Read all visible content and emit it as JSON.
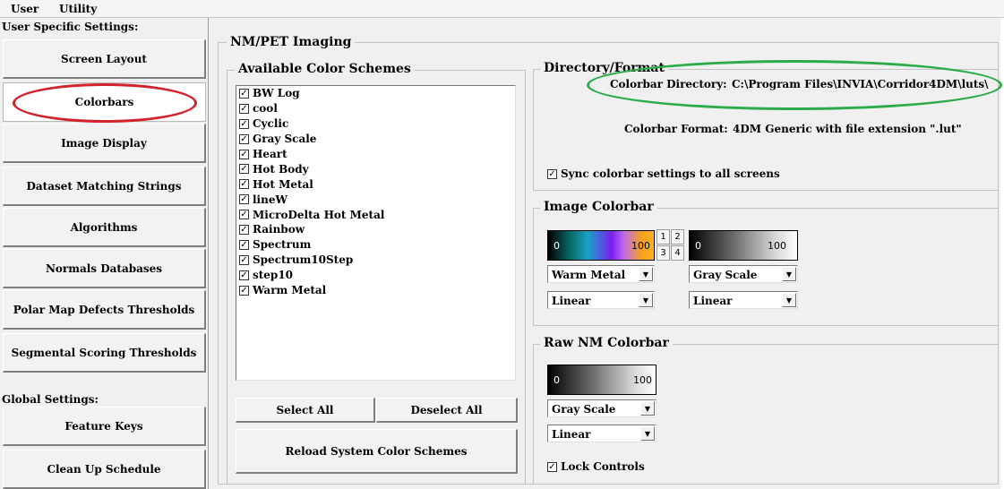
{
  "menu": {
    "user": "User",
    "utility": "Utility"
  },
  "sidebar": {
    "user_heading": "User Specific Settings:",
    "global_heading": "Global Settings:",
    "items": [
      {
        "label": "Screen Layout"
      },
      {
        "label": "Colorbars"
      },
      {
        "label": "Image Display"
      },
      {
        "label": "Dataset Matching Strings"
      },
      {
        "label": "Algorithms"
      },
      {
        "label": "Normals Databases"
      },
      {
        "label": "Polar Map Defects Thresholds"
      },
      {
        "label": "Segmental Scoring Thresholds"
      }
    ],
    "global_items": [
      {
        "label": "Feature Keys"
      },
      {
        "label": "Clean Up Schedule"
      }
    ]
  },
  "panel": {
    "title": "NM/PET Imaging",
    "schemes": {
      "title": "Available Color Schemes",
      "items": [
        "BW Log",
        "cool",
        "Cyclic",
        "Gray Scale",
        "Heart",
        "Hot Body",
        "Hot Metal",
        "lineW",
        "MicroDelta Hot Metal",
        "Rainbow",
        "Spectrum",
        "Spectrum10Step",
        "step10",
        "Warm Metal"
      ],
      "check_mark": "✓",
      "select_all": "Select All",
      "deselect_all": "Deselect All",
      "reload": "Reload System Color Schemes"
    },
    "directory": {
      "title": "Directory/Format",
      "dir_label": "Colorbar Directory:",
      "dir_value": "C:\\Program Files\\INVIA\\Corridor4DM\\luts\\",
      "format_label": "Colorbar Format:",
      "format_value": "4DM Generic with file extension \".lut\"",
      "sync_label": "Sync colorbar settings to all screens",
      "sync_checked": "✓"
    },
    "image_colorbar": {
      "title": "Image Colorbar",
      "bar1_min": "0",
      "bar1_max": "100",
      "bar2_min": "0",
      "bar2_max": "100",
      "screens": [
        "1",
        "2",
        "3",
        "4"
      ],
      "scheme1": "Warm Metal",
      "scale1": "Linear",
      "scheme2": "Gray Scale",
      "scale2": "Linear",
      "arrow": "▼"
    },
    "raw_colorbar": {
      "title": "Raw NM Colorbar",
      "bar_min": "0",
      "bar_max": "100",
      "scheme": "Gray Scale",
      "scale": "Linear",
      "lock_label": "Lock Controls",
      "lock_checked": "✓"
    }
  },
  "colors": {
    "red_highlight": "#d2222c",
    "green_highlight": "#2cab4a"
  }
}
